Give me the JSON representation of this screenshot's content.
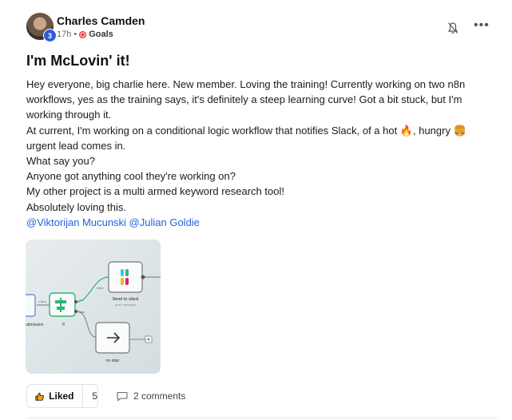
{
  "post": {
    "author": "Charles Camden",
    "level": "3",
    "time": "17h",
    "dot": "•",
    "category": "Goals",
    "title": "I'm McLovin' it!",
    "paragraphs": [
      "Hey everyone, big charlie here. New member. Loving the training! Currently working on two n8n workflows, yes as the training says, it's definitely a steep learning curve! Got a bit stuck, but I'm working through it.",
      "At current, I'm working on a conditional logic workflow that notifies Slack, of a hot 🔥, hungry 🍔 urgent lead comes in.",
      "What say you?",
      "Anyone got anything cool they're working on?",
      "My other project is a multi armed keyword research tool!",
      "Absolutely loving this."
    ],
    "mentions": "@Viktorijan Mucunski @Julian Goldie",
    "attachment": {
      "node_slack_label": "Send to slack",
      "node_slack_sublabel": "post: message",
      "node_if_label": "If",
      "node_submission_label": "ubmission",
      "node_nostep_label": "no step",
      "true_label": "true",
      "false_label": "false",
      "item_label_1": "1 item",
      "item_label_2": "1 item"
    },
    "liked_label": "Liked",
    "like_count": "5",
    "comments_label": "2 comments"
  },
  "colors": {
    "accent": "#2563d6",
    "badge": "#2f5bd8",
    "n8n_green": "#2bb673"
  }
}
